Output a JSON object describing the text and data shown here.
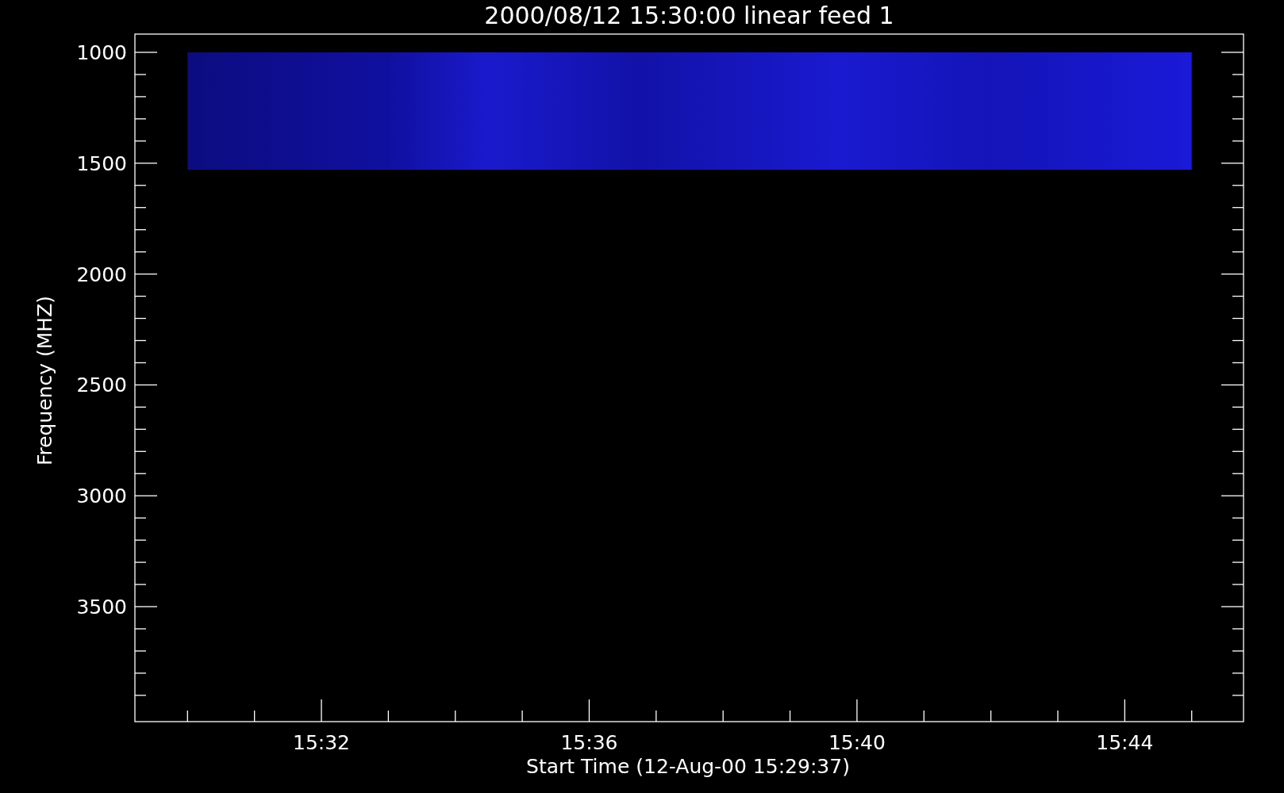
{
  "title": "2000/08/12 15:30:00 linear feed 1",
  "ylabel": "Frequency (MHZ)",
  "xlabel": "Start Time (12-Aug-00 15:29:37)",
  "yticks": [
    "1000",
    "1500",
    "2000",
    "2500",
    "3000",
    "3500"
  ],
  "xticks": [
    "15:32",
    "15:36",
    "15:40",
    "15:44"
  ]
}
